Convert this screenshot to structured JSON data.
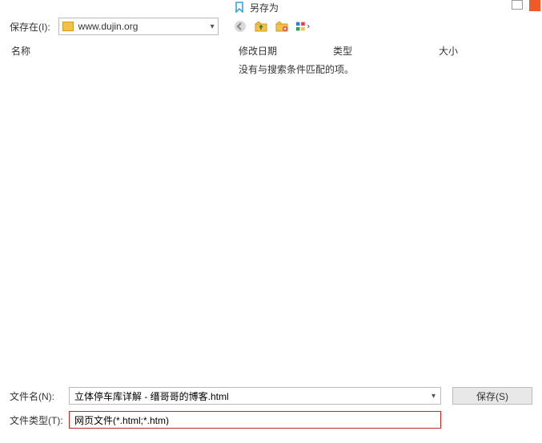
{
  "title": "另存为",
  "location": {
    "label": "保存在(I):",
    "value": "www.dujin.org"
  },
  "columns": {
    "name": "名称",
    "date": "修改日期",
    "type": "类型",
    "size": "大小"
  },
  "empty_message": "没有与搜索条件匹配的项。",
  "filename": {
    "label": "文件名(N):",
    "value": "立体停车库详解 - 缙哥哥的博客.html"
  },
  "filetype": {
    "label": "文件类型(T):",
    "value": "网页文件(*.html;*.htm)"
  },
  "buttons": {
    "save": "保存(S)"
  },
  "icons": {
    "bookmark": "bookmark-icon",
    "back": "back-icon",
    "up": "up-folder-icon",
    "new_folder": "new-folder-icon",
    "view_mode": "view-mode-icon"
  }
}
